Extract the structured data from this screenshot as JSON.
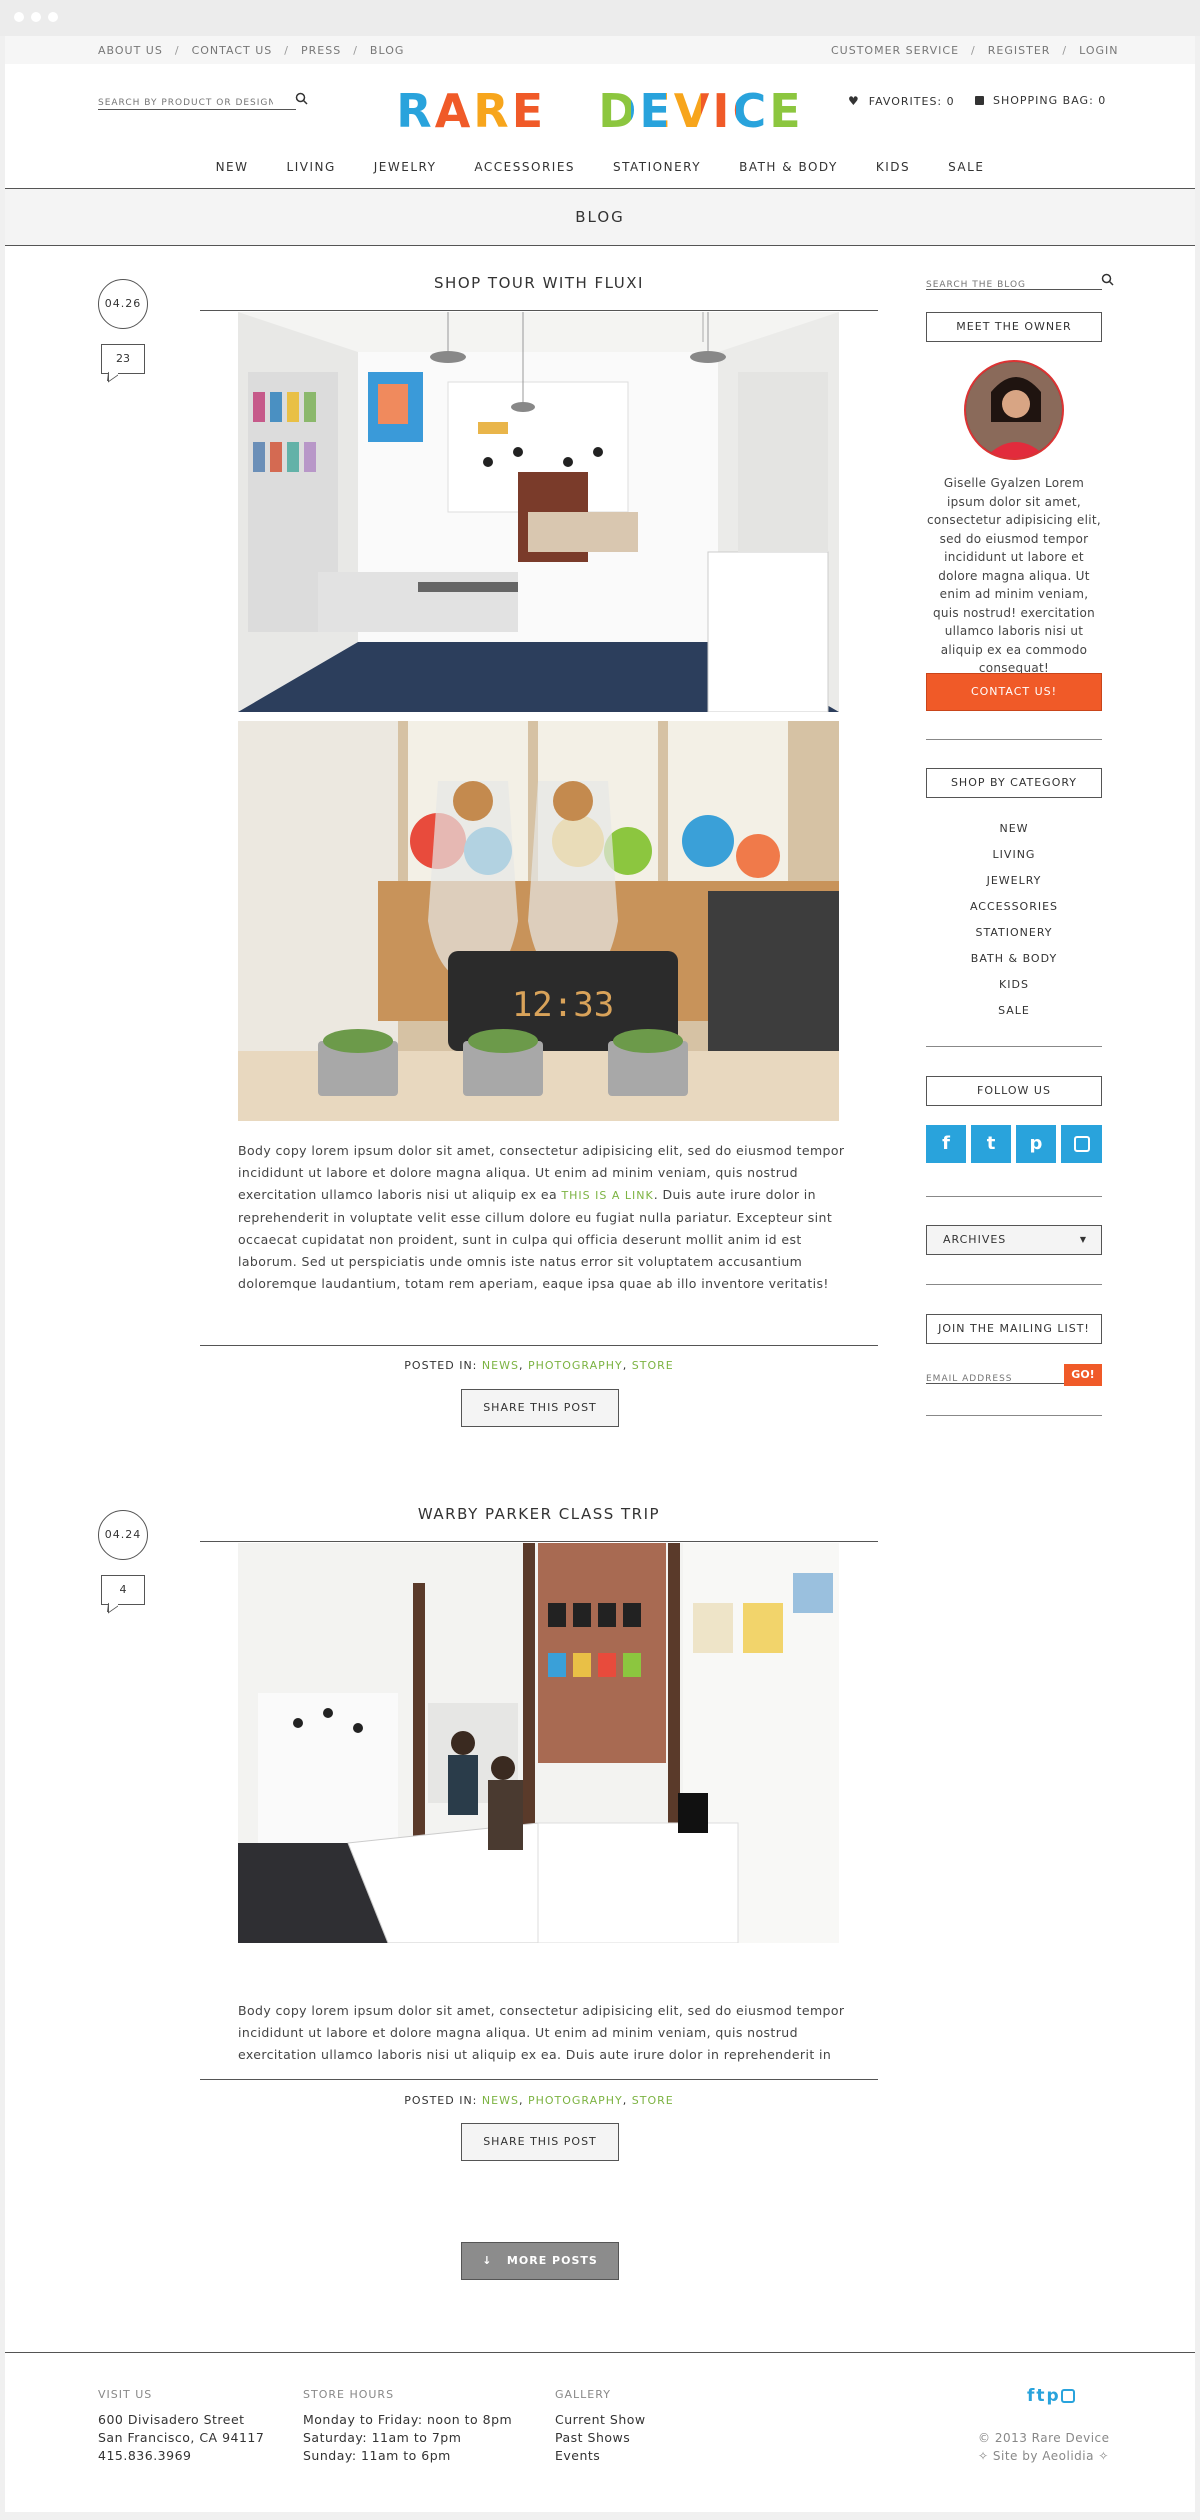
{
  "browser": {
    "dots": 3
  },
  "topbar": {
    "left": [
      "ABOUT US",
      "CONTACT US",
      "PRESS",
      "BLOG"
    ],
    "right": [
      "CUSTOMER SERVICE",
      "REGISTER",
      "LOGIN"
    ]
  },
  "header": {
    "search_placeholder": "SEARCH BY PRODUCT OR DESIGNER",
    "logo_word1": "RARE",
    "logo_word2": "DEVICE",
    "favorites": "FAVORITES: 0",
    "bag": "SHOPPING BAG: 0"
  },
  "nav": [
    "NEW",
    "LIVING",
    "JEWELRY",
    "ACCESSORIES",
    "STATIONERY",
    "BATH & BODY",
    "KIDS",
    "SALE"
  ],
  "blog_title": "BLOG",
  "posts": [
    {
      "date": "04.26",
      "comments": "23",
      "title": "SHOP TOUR WITH FLUXI",
      "body_before": "Body copy lorem ipsum dolor sit amet, consectetur adipisicing elit, sed do eiusmod tempor incididunt ut labore et dolore magna aliqua. Ut enim ad minim veniam, quis nostrud exercitation ullamco laboris nisi ut aliquip ex ea ",
      "link": "THIS IS A LINK",
      "body_after": ". Duis aute irure dolor in reprehenderit in voluptate velit esse cillum dolore eu fugiat nulla pariatur. Excepteur sint occaecat cupidatat non proident, sunt in culpa qui officia deserunt mollit anim id est laborum. Sed ut perspiciatis unde omnis iste natus error sit voluptatem accusantium doloremque laudantium, totam rem aperiam, eaque ipsa quae ab illo inventore veritatis!",
      "clock": "12:33"
    },
    {
      "date": "04.24",
      "comments": "4",
      "title": "WARBY PARKER CLASS TRIP",
      "body": "Body copy lorem ipsum dolor sit amet, consectetur adipisicing elit, sed do eiusmod tempor incididunt ut labore et dolore magna aliqua. Ut enim ad minim veniam, quis nostrud exercitation ullamco laboris nisi ut aliquip ex ea. Duis aute irure dolor in reprehenderit in"
    }
  ],
  "posted_in": {
    "label": "POSTED IN:",
    "tags": [
      "NEWS",
      "PHOTOGRAPHY",
      "STORE"
    ]
  },
  "share_label": "SHARE THIS POST",
  "more_posts": "MORE POSTS",
  "more_arrow": "↓",
  "sidebar": {
    "search_placeholder": "SEARCH THE BLOG",
    "meet_owner": "MEET THE OWNER",
    "bio": "Giselle Gyalzen Lorem ipsum dolor sit amet, consectetur adipisicing elit, sed do eiusmod tempor incididunt ut labore et dolore magna aliqua. Ut enim ad minim veniam, quis nostrud! exercitation ullamco laboris nisi ut aliquip ex ea commodo consequat!",
    "contact": "CONTACT US!",
    "shop_by": "SHOP BY CATEGORY",
    "categories": [
      "NEW",
      "LIVING",
      "JEWELRY",
      "ACCESSORIES",
      "STATIONERY",
      "BATH & BODY",
      "KIDS",
      "SALE"
    ],
    "follow": "FOLLOW US",
    "social_icons": [
      "facebook-icon",
      "twitter-icon",
      "pinterest-icon",
      "instagram-icon"
    ],
    "archives": "ARCHIVES",
    "mailing": "JOIN THE MAILING LIST!",
    "email_placeholder": "EMAIL ADDRESS",
    "go": "GO!"
  },
  "footer": {
    "visit_h": "VISIT US",
    "visit": [
      "600 Divisadero Street",
      "San Francisco, CA 94117",
      "415.836.3969"
    ],
    "hours_h": "STORE HOURS",
    "hours": [
      "Monday to Friday: noon to 8pm",
      "Saturday: 11am to 7pm",
      "Sunday: 11am to 6pm"
    ],
    "gallery_h": "GALLERY",
    "gallery": [
      "Current Show",
      "Past Shows",
      "Events"
    ],
    "copyright": "© 2013 Rare Device",
    "credit": "Site by Aeolidia"
  },
  "colors": {
    "accent_orange": "#f05a28",
    "link_green": "#7cb342",
    "social_blue": "#29a3dc",
    "logo_blue": "#29a3dc",
    "logo_orange": "#f05a28",
    "logo_green": "#8cc63f"
  }
}
